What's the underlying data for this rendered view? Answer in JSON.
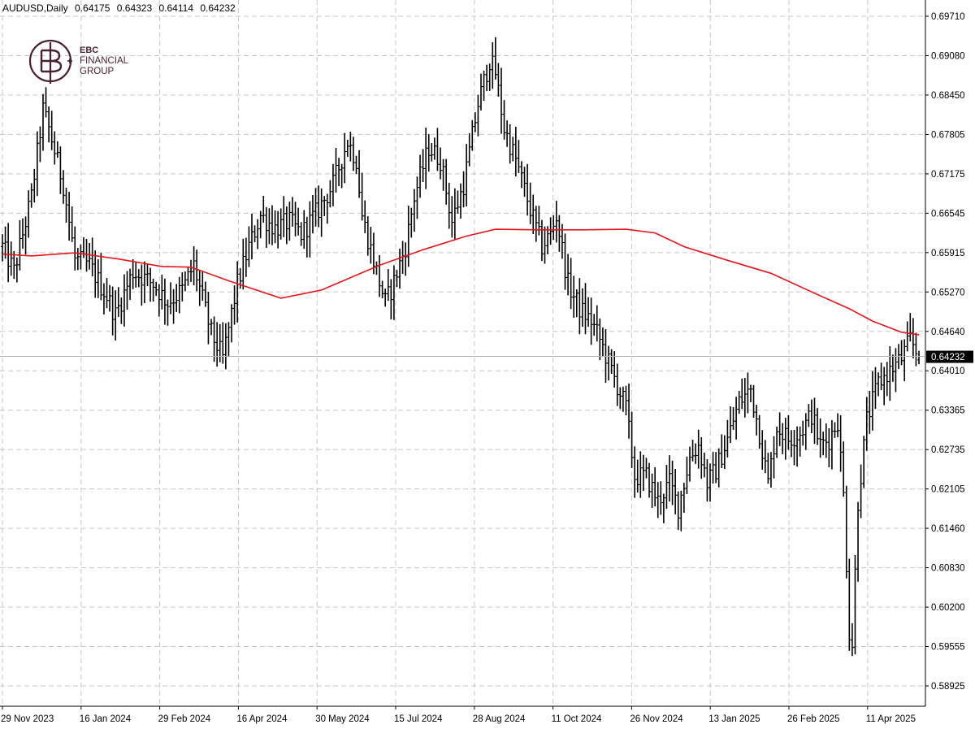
{
  "header": {
    "symbol": "AUDUSD,Daily",
    "ohlc": [
      "0.64175",
      "0.64323",
      "0.64114",
      "0.64232"
    ]
  },
  "logo": {
    "lines": [
      "EBC",
      "FINANCIAL",
      "GROUP"
    ],
    "color": "#4a2130"
  },
  "colors": {
    "background": "#ffffff",
    "bars": "#000000",
    "moving_average": "#e8141c",
    "grid": "#c8c8c8",
    "current_price_line": "#b4b4b4",
    "price_label_bg": "#000000",
    "price_label_text": "#ffffff"
  },
  "chart_data": {
    "type": "line",
    "subtype": "ohlc-bars",
    "title": "AUDUSD,Daily",
    "xlabel": "",
    "ylabel": "",
    "grid": true,
    "ylim": [
      0.58925,
      0.6971
    ],
    "y_ticks": [
      "0.69710",
      "0.69080",
      "0.68450",
      "0.67805",
      "0.67175",
      "0.66545",
      "0.65915",
      "0.65270",
      "0.64640",
      "0.64010",
      "0.63365",
      "0.62735",
      "0.62105",
      "0.61460",
      "0.60830",
      "0.60200",
      "0.59555",
      "0.58925"
    ],
    "x_ticks": [
      "29 Nov 2023",
      "16 Jan 2024",
      "29 Feb 2024",
      "16 Apr 2024",
      "30 May 2024",
      "15 Jul 2024",
      "28 Aug 2024",
      "11 Oct 2024",
      "26 Nov 2024",
      "13 Jan 2025",
      "26 Feb 2025",
      "11 Apr 2025"
    ],
    "current_price": "0.64232",
    "price_bars_anchor_points": [
      {
        "i": 0,
        "c": 0.66
      },
      {
        "i": 4,
        "c": 0.656
      },
      {
        "i": 10,
        "c": 0.668
      },
      {
        "i": 14,
        "c": 0.682
      },
      {
        "i": 16,
        "c": 0.679
      },
      {
        "i": 21,
        "c": 0.67
      },
      {
        "i": 25,
        "c": 0.658
      },
      {
        "i": 30,
        "c": 0.657
      },
      {
        "i": 36,
        "c": 0.652
      },
      {
        "i": 39,
        "c": 0.649
      },
      {
        "i": 45,
        "c": 0.656
      },
      {
        "i": 52,
        "c": 0.654
      },
      {
        "i": 57,
        "c": 0.651
      },
      {
        "i": 62,
        "c": 0.653
      },
      {
        "i": 66,
        "c": 0.657
      },
      {
        "i": 72,
        "c": 0.646
      },
      {
        "i": 76,
        "c": 0.642
      },
      {
        "i": 81,
        "c": 0.654
      },
      {
        "i": 85,
        "c": 0.66
      },
      {
        "i": 89,
        "c": 0.665
      },
      {
        "i": 94,
        "c": 0.663
      },
      {
        "i": 99,
        "c": 0.664
      },
      {
        "i": 103,
        "c": 0.662
      },
      {
        "i": 109,
        "c": 0.666
      },
      {
        "i": 114,
        "c": 0.67
      },
      {
        "i": 119,
        "c": 0.677
      },
      {
        "i": 122,
        "c": 0.674
      },
      {
        "i": 124,
        "c": 0.665
      },
      {
        "i": 129,
        "c": 0.656
      },
      {
        "i": 132,
        "c": 0.651
      },
      {
        "i": 134,
        "c": 0.653
      },
      {
        "i": 139,
        "c": 0.66
      },
      {
        "i": 142,
        "c": 0.668
      },
      {
        "i": 147,
        "c": 0.676
      },
      {
        "i": 151,
        "c": 0.674
      },
      {
        "i": 155,
        "c": 0.664
      },
      {
        "i": 159,
        "c": 0.67
      },
      {
        "i": 164,
        "c": 0.683
      },
      {
        "i": 168,
        "c": 0.69
      },
      {
        "i": 170,
        "c": 0.688
      },
      {
        "i": 173,
        "c": 0.679
      },
      {
        "i": 177,
        "c": 0.674
      },
      {
        "i": 182,
        "c": 0.666
      },
      {
        "i": 186,
        "c": 0.66
      },
      {
        "i": 189,
        "c": 0.662
      },
      {
        "i": 191,
        "c": 0.665
      },
      {
        "i": 195,
        "c": 0.654
      },
      {
        "i": 199,
        "c": 0.65
      },
      {
        "i": 203,
        "c": 0.648
      },
      {
        "i": 206,
        "c": 0.645
      },
      {
        "i": 210,
        "c": 0.64
      },
      {
        "i": 215,
        "c": 0.634
      },
      {
        "i": 218,
        "c": 0.623
      },
      {
        "i": 222,
        "c": 0.623
      },
      {
        "i": 226,
        "c": 0.619
      },
      {
        "i": 230,
        "c": 0.622
      },
      {
        "i": 233,
        "c": 0.618
      },
      {
        "i": 237,
        "c": 0.626
      },
      {
        "i": 240,
        "c": 0.628
      },
      {
        "i": 243,
        "c": 0.622
      },
      {
        "i": 246,
        "c": 0.624
      },
      {
        "i": 250,
        "c": 0.629
      },
      {
        "i": 254,
        "c": 0.635
      },
      {
        "i": 258,
        "c": 0.637
      },
      {
        "i": 261,
        "c": 0.63
      },
      {
        "i": 264,
        "c": 0.622
      },
      {
        "i": 267,
        "c": 0.631
      },
      {
        "i": 271,
        "c": 0.629
      },
      {
        "i": 275,
        "c": 0.63
      },
      {
        "i": 279,
        "c": 0.633
      },
      {
        "i": 282,
        "c": 0.628
      },
      {
        "i": 285,
        "c": 0.629
      },
      {
        "i": 288,
        "c": 0.632
      },
      {
        "i": 290,
        "c": 0.62
      },
      {
        "i": 292,
        "c": 0.598
      },
      {
        "i": 293,
        "c": 0.596
      },
      {
        "i": 295,
        "c": 0.619
      },
      {
        "i": 298,
        "c": 0.632
      },
      {
        "i": 302,
        "c": 0.638
      },
      {
        "i": 306,
        "c": 0.64
      },
      {
        "i": 310,
        "c": 0.642
      },
      {
        "i": 313,
        "c": 0.645
      },
      {
        "i": 316,
        "c": 0.6423
      }
    ],
    "moving_average": {
      "points": [
        {
          "i": 0,
          "v": 0.6588
        },
        {
          "i": 10,
          "v": 0.6585
        },
        {
          "i": 25,
          "v": 0.659
        },
        {
          "i": 40,
          "v": 0.658
        },
        {
          "i": 55,
          "v": 0.6568
        },
        {
          "i": 65,
          "v": 0.6567
        },
        {
          "i": 78,
          "v": 0.6545
        },
        {
          "i": 96,
          "v": 0.6517
        },
        {
          "i": 110,
          "v": 0.653
        },
        {
          "i": 130,
          "v": 0.657
        },
        {
          "i": 145,
          "v": 0.6595
        },
        {
          "i": 160,
          "v": 0.6617
        },
        {
          "i": 170,
          "v": 0.6628
        },
        {
          "i": 185,
          "v": 0.6627
        },
        {
          "i": 200,
          "v": 0.6627
        },
        {
          "i": 215,
          "v": 0.6628
        },
        {
          "i": 225,
          "v": 0.6622
        },
        {
          "i": 235,
          "v": 0.66
        },
        {
          "i": 250,
          "v": 0.6578
        },
        {
          "i": 265,
          "v": 0.6557
        },
        {
          "i": 280,
          "v": 0.6525
        },
        {
          "i": 292,
          "v": 0.65
        },
        {
          "i": 300,
          "v": 0.648
        },
        {
          "i": 310,
          "v": 0.6462
        },
        {
          "i": 316,
          "v": 0.6458
        }
      ]
    }
  }
}
